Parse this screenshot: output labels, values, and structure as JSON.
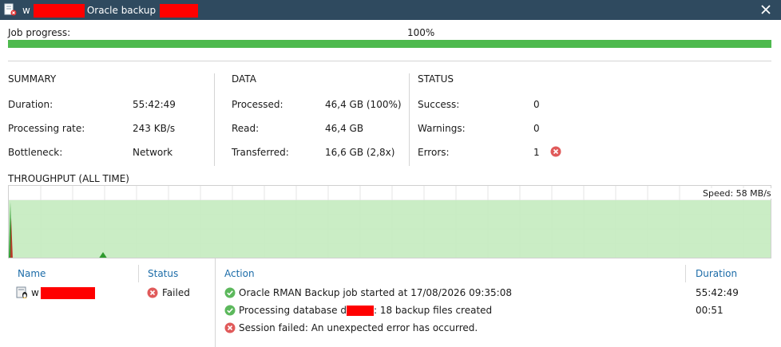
{
  "window": {
    "title_prefix": "w",
    "title_mid": "Oracle backup",
    "close_icon": "close-icon"
  },
  "progress": {
    "label": "Job progress:",
    "percent_text": "100%",
    "value": 1.0,
    "color": "#4eb94e"
  },
  "summary": {
    "heading": "SUMMARY",
    "rows": [
      {
        "label": "Duration:",
        "value": "55:42:49"
      },
      {
        "label": "Processing rate:",
        "value": "243 KB/s"
      },
      {
        "label": "Bottleneck:",
        "value": "Network"
      }
    ]
  },
  "data_section": {
    "heading": "DATA",
    "rows": [
      {
        "label": "Processed:",
        "value": "46,4 GB (100%)"
      },
      {
        "label": "Read:",
        "value": "46,4 GB"
      },
      {
        "label": "Transferred:",
        "value": "16,6 GB (2,8x)"
      }
    ]
  },
  "status": {
    "heading": "STATUS",
    "rows": [
      {
        "label": "Success:",
        "value": "0"
      },
      {
        "label": "Warnings:",
        "value": "0"
      },
      {
        "label": "Errors:",
        "value": "1"
      }
    ],
    "error_icon": "error-icon",
    "error_color": "#e05050"
  },
  "throughput": {
    "heading": "THROUGHPUT (ALL TIME)",
    "speed_text": "Speed: 58 MB/s",
    "fill_color": "#c6ecc0"
  },
  "objects": {
    "headers": {
      "name": "Name",
      "status": "Status"
    },
    "rows": [
      {
        "name": "w",
        "status": "Failed",
        "icon": "linux-server-icon",
        "status_icon": "error-icon"
      }
    ]
  },
  "log": {
    "headers": {
      "action": "Action",
      "duration": "Duration"
    },
    "rows": [
      {
        "icon": "success-icon",
        "text": "Oracle RMAN Backup job started at 17/08/2026 09:35:08",
        "duration": "55:42:49"
      },
      {
        "icon": "success-icon",
        "text_before": "Processing database d",
        "text_after": ": 18 backup files created",
        "duration": "00:51"
      },
      {
        "icon": "error-icon",
        "text": "Session failed: An unexpected error has occurred.",
        "duration": ""
      }
    ]
  }
}
